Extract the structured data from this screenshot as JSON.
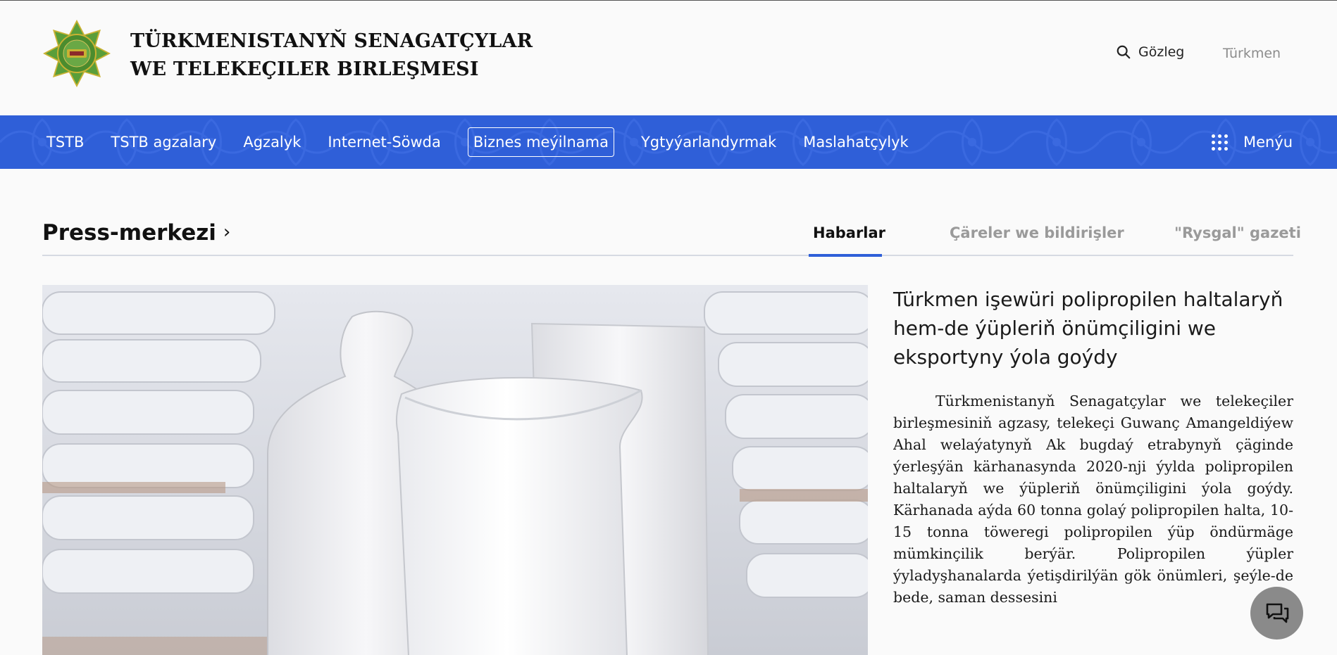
{
  "header": {
    "org_title_line1": "TÜRKMENISTANYŇ SENAGATÇYLAR",
    "org_title_line2": "WE TELEKEÇILER BIRLEŞMESI",
    "logo_icon": "tstb-emblem-icon",
    "search_label": "Gözleg",
    "search_icon": "search-icon",
    "language": "Türkmen"
  },
  "nav": {
    "items": [
      {
        "label": "TSTB"
      },
      {
        "label": "TSTB agzalary"
      },
      {
        "label": "Agzalyk"
      },
      {
        "label": "Internet-Söwda"
      },
      {
        "label": "Biznes meýilnama"
      },
      {
        "label": "Ygtyýarlandyrmak"
      },
      {
        "label": "Maslahatçylyk"
      }
    ],
    "active_index": 4,
    "menu_label": "Menýu",
    "menu_icon": "grid-dots-icon"
  },
  "press": {
    "title": "Press-merkezi",
    "tabs": [
      {
        "label": "Habarlar",
        "active": true
      },
      {
        "label": "Çäreler we bildirişler",
        "active": false
      },
      {
        "label": "\"Rysgal\" gazeti",
        "active": false
      }
    ]
  },
  "article": {
    "title": "Türkmen işewüri polipropilen haltalaryň hem-de ýüpleriň önümçiligini we eksportyny ýola goýdy",
    "body": "Türkmenistanyň Senagatçylar we telekeçiler birleşmesiniň agzasy, telekeçi Guwanç Amangeldiýew Ahal welaýatynyň Ak bugdaý etrabynyň çäginde ýerleşýän kärhanasynda 2020-nji ýylda polipropilen haltalaryň we ýüpleriň önümçiligini ýola goýdy. Kärhanada aýda 60 tonna golaý polipropilen halta, 10-15 tonna töweregi polipropilen ýüp öndürmäge mümkinçilik berýär. Polipropilen ýüpler ýyladyşhanalarda ýetişdirilýän gök önümleri, şeýle-de bede, saman dessesini"
  },
  "chat": {
    "icon": "chat-bubbles-icon"
  },
  "colors": {
    "brand_blue": "#2f5fd8",
    "chat_gray": "#8a8a8a"
  }
}
